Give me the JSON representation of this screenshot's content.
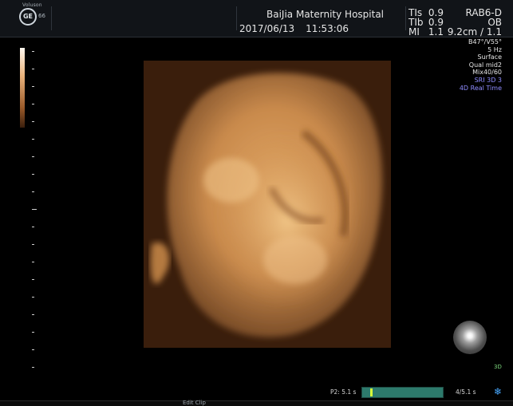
{
  "header": {
    "brand": "Voluson",
    "logo": "GE",
    "gain_value": "66",
    "hospital": "BaiJia Maternity Hospital",
    "date": "2017/06/13",
    "time": "11:53:06",
    "ti": [
      {
        "key": "TIs",
        "value": "0.9"
      },
      {
        "key": "TIb",
        "value": "0.9"
      },
      {
        "key": "MI",
        "value": "1.1"
      }
    ],
    "probe": {
      "name": "RAB6-D",
      "preset": "OB",
      "depth_scale": "9.2cm / 1.1"
    }
  },
  "params": [
    "B47°/V55°",
    "5 Hz",
    "Surface",
    "Qual mid2",
    "Mix40/60"
  ],
  "params_highlight": [
    "SRI 3D 3",
    "4D Real Time"
  ],
  "render_label": "3D",
  "cine": {
    "p2_label": "P2:",
    "p2_time": "5.1 s",
    "frames_label": "4/5.1 s",
    "progress_fraction": 0.1
  },
  "footer": {
    "edit_clip": "Edit Clip"
  },
  "icons": {
    "logo": "ge-logo-icon",
    "orb": "light-source-icon",
    "snow": "snowflake-icon"
  },
  "colors": {
    "tissue": "#d38a4c",
    "highlight": "#8f8cff",
    "accent3d": "#7cd67c",
    "cine": "#2d7a6c"
  }
}
